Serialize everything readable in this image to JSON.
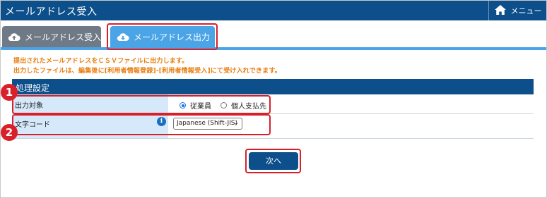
{
  "header": {
    "title": "メールアドレス受入",
    "menu_label": "メニュー"
  },
  "tabs": [
    {
      "label": "メールアドレス受入",
      "active": false,
      "icon": "cloud-upload-icon"
    },
    {
      "label": "メールアドレス出力",
      "active": true,
      "icon": "cloud-download-icon"
    }
  ],
  "notices": [
    "提出されたメールアドレスをＣＳＶファイルに出力します。",
    "出力したファイルは、編集後に[利用者情報登録]-[利用者情報受入]にて受け入れできます。"
  ],
  "section": {
    "title": "処理設定",
    "output_target": {
      "label": "出力対象",
      "options": [
        {
          "label": "従業員",
          "selected": true
        },
        {
          "label": "個人支払先",
          "selected": false
        }
      ]
    },
    "charset": {
      "label": "文字コード",
      "selected": "Japanese (Shift-JIS)"
    }
  },
  "badges": [
    "1",
    "2"
  ],
  "next_button": "次へ",
  "colors": {
    "header": "#0d4f8b",
    "active_tab": "#4aa4e6",
    "inactive_tab": "#6f7a86",
    "notice": "#e87c0c",
    "highlight": "#d8202a",
    "label_bg": "#d6e9fa"
  }
}
